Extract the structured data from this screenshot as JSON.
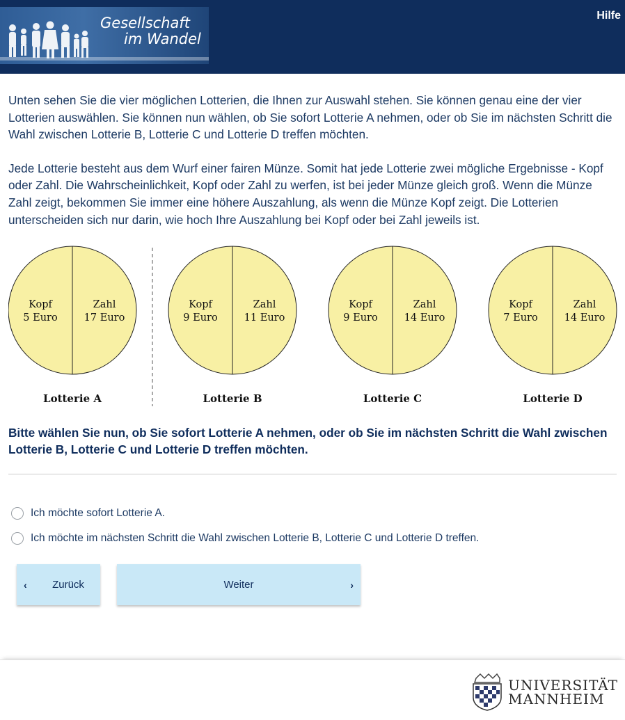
{
  "header": {
    "logo_line1": "Gesellschaft",
    "logo_line2": "im Wandel",
    "help_label": "Hilfe",
    "background_color": "#0f2d5c"
  },
  "content": {
    "paragraph1": "Unten sehen Sie die vier möglichen Lotterien, die Ihnen zur Auswahl stehen. Sie können genau eine der vier Lotterien auswählen. Sie können nun wählen, ob Sie sofort Lotterie A nehmen, oder ob Sie im nächsten Schritt die Wahl zwischen Lotterie B, Lotterie C und Lotterie D treffen möchten.",
    "paragraph2": "Jede Lotterie besteht aus dem Wurf einer fairen Münze. Somit hat jede Lotterie zwei mögliche Ergebnisse - Kopf oder Zahl. Die Wahrscheinlichkeit, Kopf oder Zahl zu werfen, ist bei jeder Münze gleich groß. Wenn die Münze Zahl zeigt, bekommen Sie immer eine höhere Auszahlung, als wenn die Münze Kopf zeigt. Die Lotterien unterscheiden sich nur darin, wie hoch Ihre Auszahlung bei Kopf oder bei Zahl jeweils ist."
  },
  "lotteries": [
    {
      "name": "Lotterie A",
      "left_label": "Kopf",
      "left_value": "5 Euro",
      "right_label": "Zahl",
      "right_value": "17 Euro"
    },
    {
      "name": "Lotterie B",
      "left_label": "Kopf",
      "left_value": "9 Euro",
      "right_label": "Zahl",
      "right_value": "11 Euro"
    },
    {
      "name": "Lotterie C",
      "left_label": "Kopf",
      "left_value": "9 Euro",
      "right_label": "Zahl",
      "right_value": "14 Euro"
    },
    {
      "name": "Lotterie D",
      "left_label": "Kopf",
      "left_value": "7 Euro",
      "right_label": "Zahl",
      "right_value": "14 Euro"
    }
  ],
  "lottery_fill_color": "#f8f0a4",
  "question": "Bitte wählen Sie nun, ob Sie sofort Lotterie A nehmen, oder ob Sie im nächsten Schritt die Wahl zwischen Lotterie B, Lotterie C und Lotterie D treffen möchten.",
  "options": [
    {
      "label": "Ich möchte sofort Lotterie A.",
      "selected": false
    },
    {
      "label": "Ich möchte im nächsten Schritt die Wahl zwischen Lotterie B, Lotterie C und Lotterie D treffen.",
      "selected": false
    }
  ],
  "buttons": {
    "back_label": "Zurück",
    "next_label": "Weiter",
    "button_color": "#c9e8f7"
  },
  "footer": {
    "uni_line1": "UNIVERSITÄT",
    "uni_line2": "MANNHEIM"
  }
}
